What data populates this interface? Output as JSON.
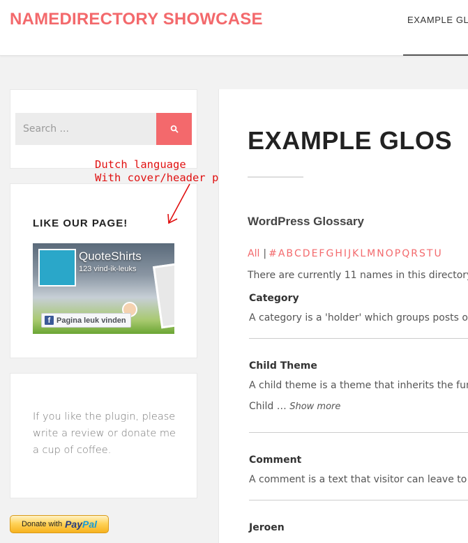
{
  "header": {
    "site_title": "NAMEDIRECTORY SHOWCASE",
    "nav_item": "EXAMPLE GLO"
  },
  "sidebar": {
    "search": {
      "placeholder": "Search ..."
    },
    "annotation": {
      "line1": "Dutch language",
      "line2": "With cover/header photo"
    },
    "like_widget": {
      "title": "LIKE OUR PAGE!",
      "page_name": "QuoteShirts",
      "likes_text": "123 vind-ik-leuks",
      "like_button": "Pagina leuk vinden"
    },
    "plugin_text": "If you like the plugin, please write a review or donate me a cup of coffee.",
    "paypal": {
      "donate_text": "Donate with",
      "logo_pay": "Pay",
      "logo_pal": "Pal"
    }
  },
  "main": {
    "page_title": "EXAMPLE GLOS",
    "glossary_title": "WordPress Glossary",
    "alpha_all": "All",
    "alpha_letters": [
      "#",
      "A",
      "B",
      "C",
      "D",
      "E",
      "F",
      "G",
      "H",
      "I",
      "J",
      "K",
      "L",
      "M",
      "N",
      "O",
      "P",
      "Q",
      "R",
      "S",
      "T",
      "U"
    ],
    "count_text": "There are currently 11 names in this directory",
    "entries": [
      {
        "name": "Category",
        "description": "A category is a 'holder' which groups posts o"
      },
      {
        "name": "Child Theme",
        "description": "A child theme is a theme that inherits the fun",
        "more_text": "Child  …",
        "show_more": "Show more"
      },
      {
        "name": "Comment",
        "description": "A comment is a text that visitor can leave to y"
      },
      {
        "name": "Jeroen"
      }
    ]
  },
  "colors": {
    "accent": "#f3696c",
    "annotation": "#e01010"
  }
}
